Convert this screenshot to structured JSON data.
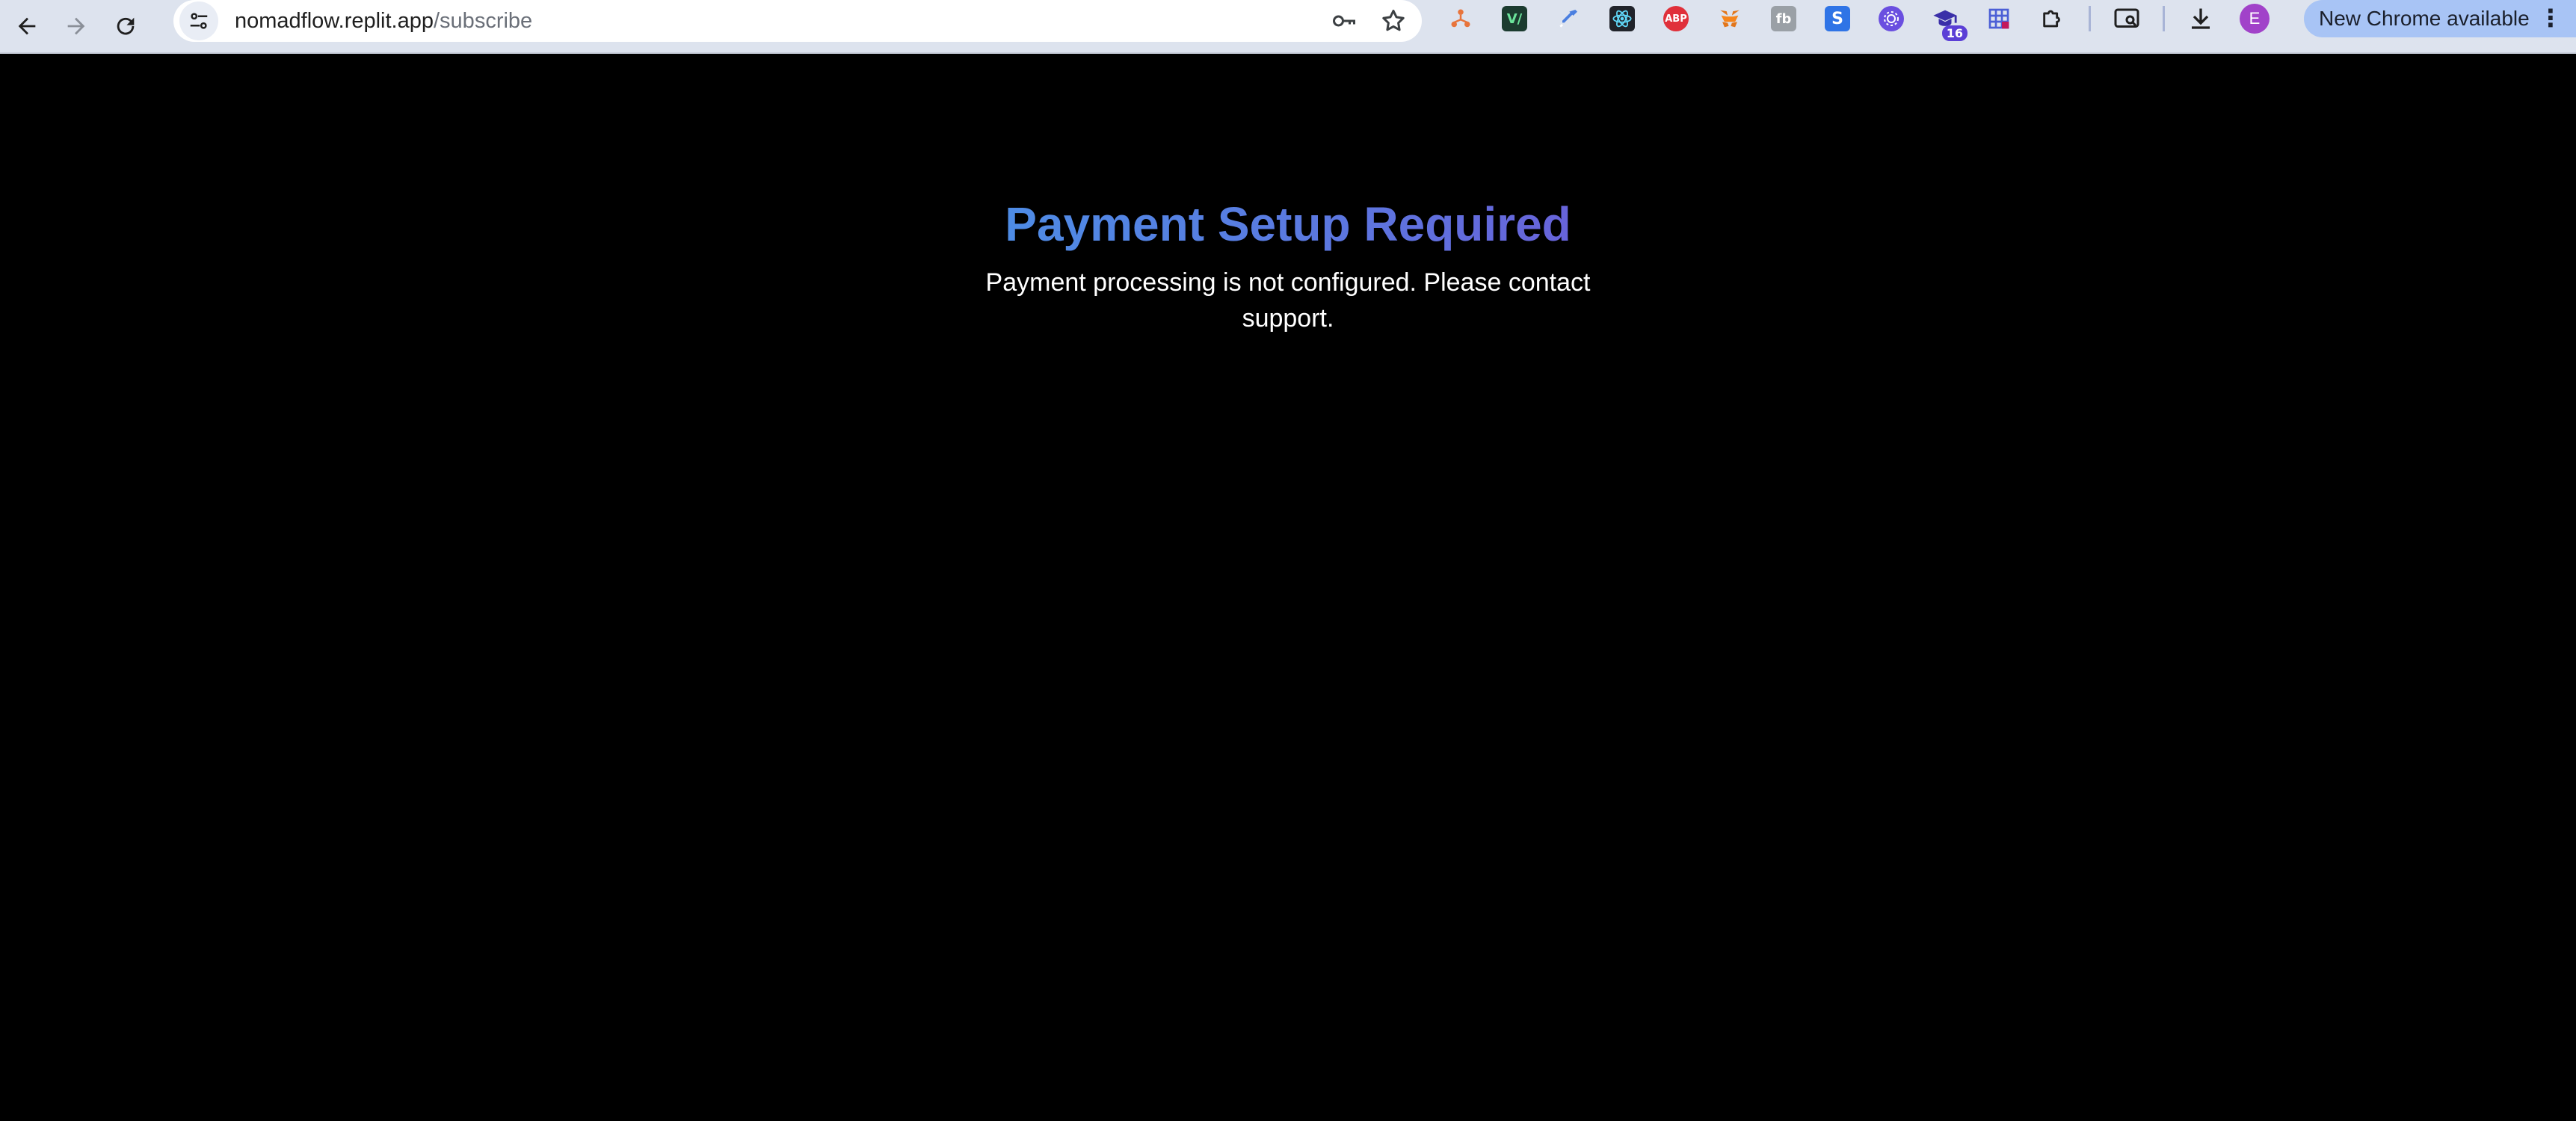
{
  "browser": {
    "url_host": "nomadflow.replit.app",
    "url_path": "/subscribe",
    "extensions": [
      {
        "icon": "orange-network-ext-icon",
        "color": "#e8743b"
      },
      {
        "icon": "vim-ext-icon",
        "color": "#1b3b2f",
        "label": "V/"
      },
      {
        "icon": "eyedropper-ext-icon",
        "color": "#4a7fe0"
      },
      {
        "icon": "react-devtools-ext-icon",
        "color": "#20232a"
      },
      {
        "icon": "adblock-plus-ext-icon",
        "color": "#e0303a",
        "label": "ABP"
      },
      {
        "icon": "metamask-ext-icon",
        "color": "#f0851a"
      },
      {
        "icon": "fb-ext-icon",
        "color": "#9aa0a6",
        "label": "fb"
      },
      {
        "icon": "s-ext-icon",
        "color": "#2f74e6",
        "label": "S"
      },
      {
        "icon": "gear-purple-ext-icon",
        "color": "#6a4fe0"
      },
      {
        "icon": "graduation-cap-ext-icon",
        "color": "#3a2fa8",
        "badge": "16"
      },
      {
        "icon": "grid-ext-icon",
        "color": "#4b5fd6"
      }
    ],
    "profile_initial": "E",
    "update_label": "New Chrome available"
  },
  "page": {
    "title": "Payment Setup Required",
    "message": "Payment processing is not configured. Please contact support."
  }
}
